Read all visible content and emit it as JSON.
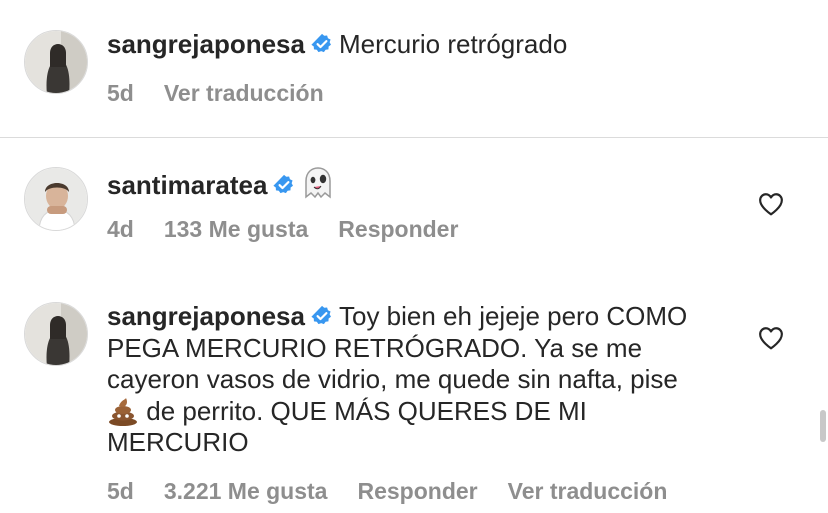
{
  "comments": [
    {
      "username": "sangrejaponesa",
      "text": "Mercurio retrógrado",
      "time": "5d",
      "translate": "Ver traducción"
    },
    {
      "username": "santimaratea",
      "emoji": "ghost",
      "time": "4d",
      "likes": "133 Me gusta",
      "reply": "Responder"
    },
    {
      "username": "sangrejaponesa",
      "text_before_emoji": "Toy bien eh jejeje pero COMO PEGA MERCURIO RETRÓGRADO. Ya se me cayeron vasos de vidrio, me quede sin nafta, pise",
      "emoji": "poop",
      "text_after_emoji": "de perrito. QUE MÁS QUERES DE MI MERCURIO",
      "time": "5d",
      "likes": "3.221 Me gusta",
      "reply": "Responder",
      "translate": "Ver traducción"
    }
  ],
  "colors": {
    "verified": "#3897f0",
    "meta_text": "#8e8e8e",
    "text": "#262626"
  },
  "icons": [
    "verified-badge-icon",
    "heart-icon",
    "ghost-emoji",
    "poop-emoji"
  ]
}
